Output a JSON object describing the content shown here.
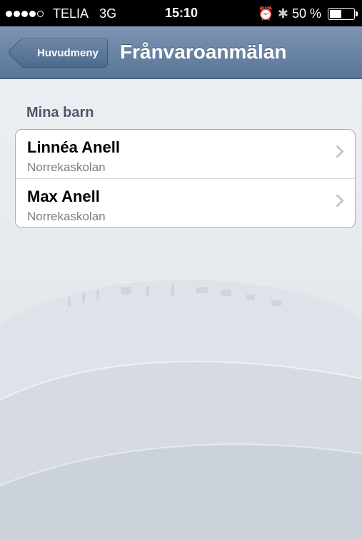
{
  "status_bar": {
    "carrier": "TELIA",
    "network": "3G",
    "time": "15:10",
    "battery_text": "50 %",
    "battery_level": 0.5,
    "icons": [
      "alarm-icon",
      "bluetooth-icon",
      "battery-icon"
    ]
  },
  "nav": {
    "back_label": "Huvudmeny",
    "title": "Frånvaroanmälan"
  },
  "section": {
    "header": "Mina barn",
    "items": [
      {
        "name": "Linnéa Anell",
        "school": "Norrekaskolan"
      },
      {
        "name": "Max Anell",
        "school": "Norrekaskolan"
      }
    ]
  }
}
